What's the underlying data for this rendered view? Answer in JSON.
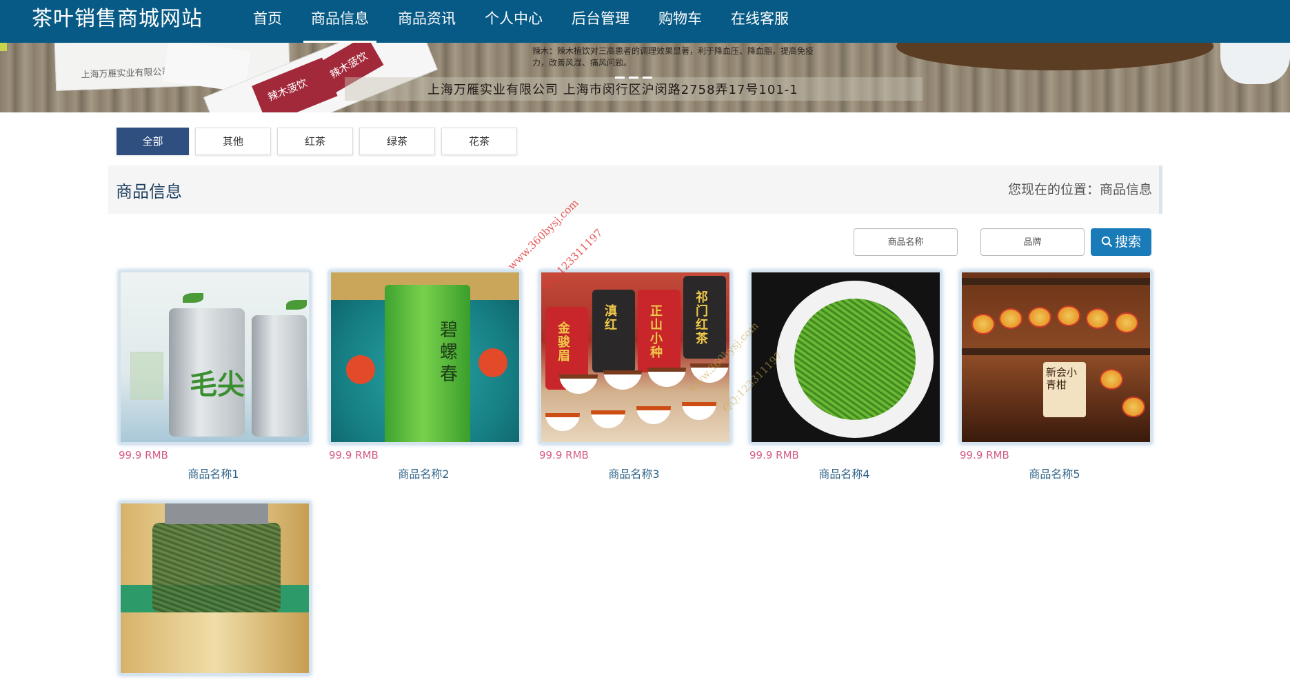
{
  "header": {
    "title": "茶叶销售商城网站",
    "nav": [
      "首页",
      "商品信息",
      "商品资讯",
      "个人中心",
      "后台管理",
      "购物车",
      "在线客服"
    ],
    "active_index": 1
  },
  "banner": {
    "address": "上海万雁实业有限公司  上海市闵行区沪闵路2758弄17号101-1",
    "company": "上海万雁实业有限公司",
    "product_text": "辣木：辣木植饮对三高患者的调理效果显著，利于降血压、降血脂，提高免疫力，改善风湿、痛风问题。",
    "sachet_text": "辣木菠饮"
  },
  "categories": [
    {
      "label": "全部",
      "active": true
    },
    {
      "label": "其他",
      "active": false
    },
    {
      "label": "红茶",
      "active": false
    },
    {
      "label": "绿茶",
      "active": false
    },
    {
      "label": "花茶",
      "active": false
    }
  ],
  "title_bar": {
    "title": "商品信息",
    "location": "您现在的位置：商品信息"
  },
  "search": {
    "name_placeholder": "商品名称",
    "brand_placeholder": "品牌",
    "button_label": "搜索"
  },
  "products": [
    {
      "price": "99.9 RMB",
      "name": "商品名称1",
      "image_text": "毛尖"
    },
    {
      "price": "99.9 RMB",
      "name": "商品名称2",
      "image_text": "碧螺春"
    },
    {
      "price": "99.9 RMB",
      "name": "商品名称3",
      "image_text": [
        "金骏眉",
        "滇红",
        "正山小种",
        "祁门红茶"
      ]
    },
    {
      "price": "99.9 RMB",
      "name": "商品名称4"
    },
    {
      "price": "99.9 RMB",
      "name": "商品名称5",
      "image_text": "新会小青柑"
    },
    {
      "price": "",
      "name": ""
    }
  ],
  "watermark": {
    "site": "www.360bysj.com",
    "qq": "QQ:123311197"
  },
  "colors": {
    "header_bg": "#075a85",
    "active_category": "#2e4f7f",
    "search_button": "#1a7bb9",
    "price": "#d45a86",
    "product_name": "#2d6287",
    "watermark": "#e33a3a"
  }
}
